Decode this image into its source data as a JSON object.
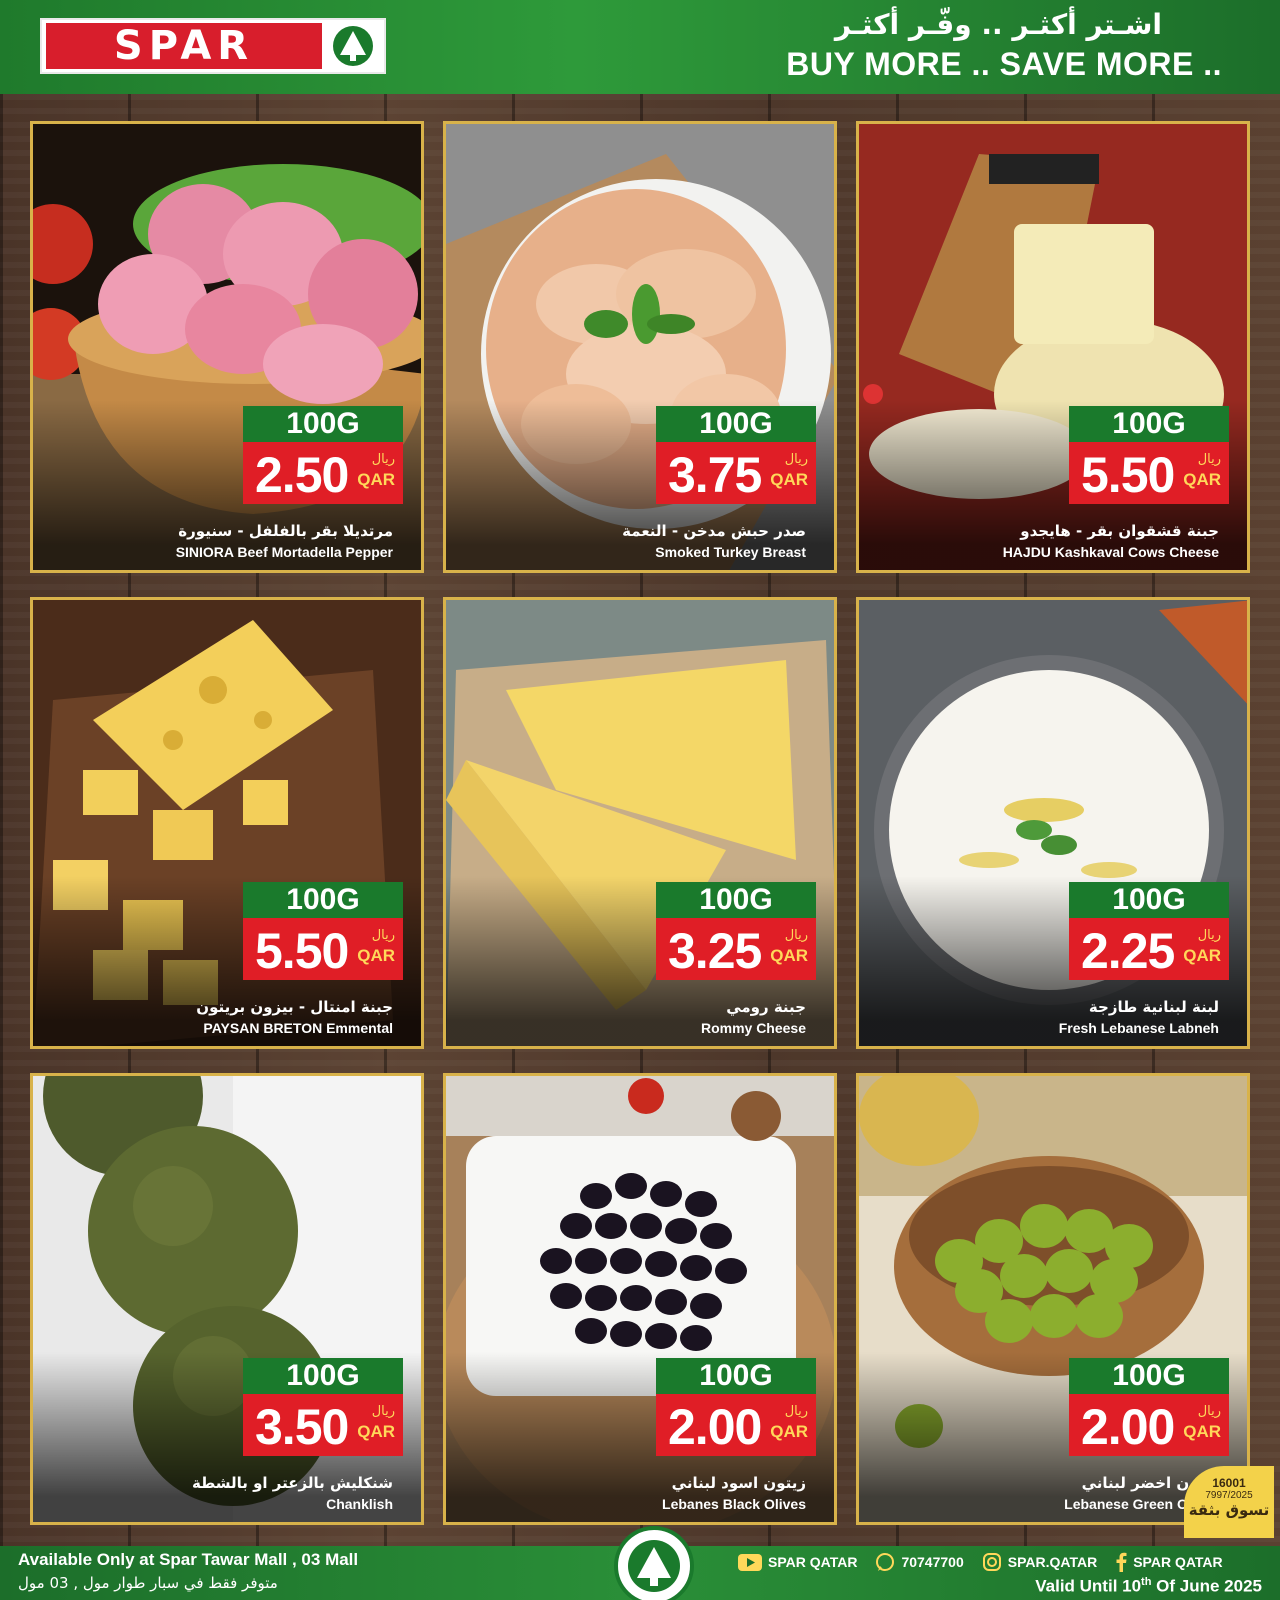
{
  "header": {
    "brand": "SPAR",
    "tagline_ar": "اشـتر أكثـر .. وفّـر أكثـر",
    "tagline_en": "BUY MORE .. SAVE MORE .."
  },
  "products": [
    {
      "weight": "100G",
      "price": "2.50",
      "currency_ar": "ريال",
      "currency_en": "QAR",
      "name_ar": "مرتديلا بقر بالفلفل - سنيورة",
      "name_en": "SINIORA Beef Mortadella Pepper",
      "image": "mortadella"
    },
    {
      "weight": "100G",
      "price": "3.75",
      "currency_ar": "ريال",
      "currency_en": "QAR",
      "name_ar": "صدر حبش مدخن - النعمة",
      "name_en": "Smoked Turkey Breast",
      "image": "turkey"
    },
    {
      "weight": "100G",
      "price": "5.50",
      "currency_ar": "ريال",
      "currency_en": "QAR",
      "name_ar": "جبنة قشقوان بقر - هايجدو",
      "name_en": "HAJDU  Kashkaval Cows Cheese",
      "image": "kashkaval"
    },
    {
      "weight": "100G",
      "price": "5.50",
      "currency_ar": "ريال",
      "currency_en": "QAR",
      "name_ar": "جبنة امنتال - بيزون بريتون",
      "name_en": "PAYSAN BRETON Emmental",
      "image": "emmental"
    },
    {
      "weight": "100G",
      "price": "3.25",
      "currency_ar": "ريال",
      "currency_en": "QAR",
      "name_ar": "جبنة رومي",
      "name_en": "Rommy Cheese",
      "image": "rommy"
    },
    {
      "weight": "100G",
      "price": "2.25",
      "currency_ar": "ريال",
      "currency_en": "QAR",
      "name_ar": "لبنة لبنانية طازجة",
      "name_en": "Fresh Lebanese Labneh",
      "image": "labneh"
    },
    {
      "weight": "100G",
      "price": "3.50",
      "currency_ar": "ريال",
      "currency_en": "QAR",
      "name_ar": "شنكليش بالزعتر او بالشطة",
      "name_en": "Chanklish",
      "image": "chanklish"
    },
    {
      "weight": "100G",
      "price": "2.00",
      "currency_ar": "ريال",
      "currency_en": "QAR",
      "name_ar": "زيتون اسود لبناني",
      "name_en": "Lebanes Black Olives",
      "image": "black-olives"
    },
    {
      "weight": "100G",
      "price": "2.00",
      "currency_ar": "ريال",
      "currency_en": "QAR",
      "name_ar": "زيتون اخضر لبناني",
      "name_en": "Lebanese Green Olives",
      "image": "green-olives"
    }
  ],
  "footer": {
    "availability_en": "Available Only at Spar Tawar Mall ,  03 Mall",
    "availability_ar": "متوفر فقط في سبار طوار مول , 03 مول",
    "youtube": "SPAR QATAR",
    "whatsapp": "70747700",
    "instagram": "SPAR.QATAR",
    "facebook": "SPAR QATAR",
    "valid_prefix": "Valid Until 10",
    "valid_sup": "th",
    "valid_suffix": " Of June 2025"
  },
  "permit": {
    "text_ar": "تسوق بثقة",
    "number": "16001",
    "ref": "7997/2025"
  },
  "colors": {
    "header_green": "#1f7a2c",
    "brand_red": "#d81e2c",
    "tag_green": "#1a7a2c",
    "tag_red": "#e01e26",
    "card_border": "#d8b24a"
  }
}
